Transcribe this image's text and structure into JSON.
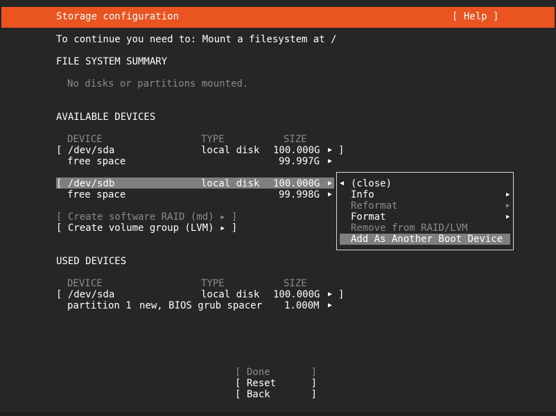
{
  "header": {
    "title": "Storage configuration",
    "help": "[ Help ]"
  },
  "message": "To continue you need to: Mount a filesystem at /",
  "fs_summary": {
    "heading": "FILE SYSTEM SUMMARY",
    "empty": "No disks or partitions mounted."
  },
  "available": {
    "heading": "AVAILABLE DEVICES",
    "col_device": "DEVICE",
    "col_type": "TYPE",
    "col_size": "SIZE",
    "sda": {
      "name": "[ /dev/sda",
      "type": "local disk",
      "size": "100.000G",
      "close": "]"
    },
    "sda_free": {
      "name": "free space",
      "size": "99.997G"
    },
    "sdb": {
      "name": "[ /dev/sdb",
      "type": "local disk",
      "size": "100.000G"
    },
    "sdb_free": {
      "name": "free space",
      "size": "99.998G"
    },
    "create_raid": "[ Create software RAID (md) ▸ ]",
    "create_lvm": "[ Create volume group (LVM) ▸ ]"
  },
  "menu": {
    "items": [
      {
        "label": "(close)",
        "enabled": true
      },
      {
        "label": "Info",
        "enabled": true
      },
      {
        "label": "Reformat",
        "enabled": false
      },
      {
        "label": "Format",
        "enabled": true
      },
      {
        "label": "Remove from RAID/LVM",
        "enabled": false
      },
      {
        "label": "Add As Another Boot Device",
        "enabled": true,
        "highlighted": true
      }
    ]
  },
  "used": {
    "heading": "USED DEVICES",
    "col_device": "DEVICE",
    "col_type": "TYPE",
    "col_size": "SIZE",
    "sda": {
      "name": "[ /dev/sda",
      "type": "local disk",
      "size": "100.000G",
      "close": "]"
    },
    "part1": {
      "name": "partition 1",
      "type": "new, BIOS grub spacer",
      "size": "1.000M"
    }
  },
  "buttons": {
    "done": "[ Done       ]",
    "reset": "[ Reset      ]",
    "back": "[ Back       ]"
  },
  "colors": {
    "accent": "#e95420",
    "background": "#262626",
    "highlight": "#7f7f7f",
    "disabled": "#8b8b8b"
  }
}
